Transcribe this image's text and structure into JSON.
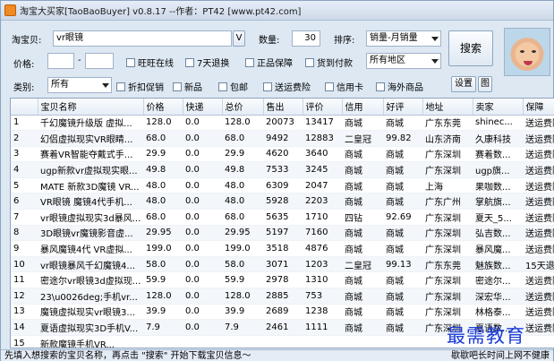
{
  "window": {
    "title": "淘宝大买家[TaoBaoBuyer] v0.8.17 --作者：PT42 [www.pt42.com]"
  },
  "search": {
    "label": "淘宝贝:",
    "value": "vr眼镜",
    "v_button": "V",
    "count_label": "数量:",
    "count_value": "30",
    "sort_label": "排序:",
    "sort_value": "销量-月销量",
    "search_button": "搜索"
  },
  "filters": {
    "price_label": "价格:",
    "price_sep": "-",
    "price_min": "",
    "price_max": "",
    "checks_row1": [
      "旺旺在线",
      "7天退换",
      "正品保障",
      "货到付款"
    ],
    "region_value": "所有地区",
    "category_label": "类别:",
    "category_value": "所有",
    "checks_row2": [
      "折扣促销",
      "新品",
      "包邮",
      "送运费险",
      "信用卡",
      "海外商品"
    ],
    "settings_button": "设置",
    "image_button": "图"
  },
  "table": {
    "columns": [
      "",
      "宝贝名称",
      "价格",
      "快递",
      "总价",
      "售出",
      "评价",
      "信用",
      "好评",
      "地址",
      "卖家",
      "保障"
    ],
    "rows": [
      [
        "1",
        "千幻魔镜升级版 虚拟...",
        "128.0",
        "0.0",
        "128.0",
        "20073",
        "13417",
        "商城",
        "商城",
        "广东东莞",
        "shinec...",
        "送运费险"
      ],
      [
        "2",
        "幻侣虚拟现实VR眼睛...",
        "68.0",
        "0.0",
        "68.0",
        "9492",
        "12883",
        "二皇冠",
        "99.82",
        "山东济南",
        "久康科技",
        "送运费险"
      ],
      [
        "3",
        "赛着VR智能夺戴式手...",
        "29.9",
        "0.0",
        "29.9",
        "4620",
        "3640",
        "商城",
        "商城",
        "广东深圳",
        "赛着数...",
        "送运费险"
      ],
      [
        "4",
        "ugp新款vr虚拟现实眼...",
        "49.8",
        "0.0",
        "49.8",
        "7533",
        "3245",
        "商城",
        "商城",
        "广东深圳",
        "ugp旗...",
        "送运费险"
      ],
      [
        "5",
        "MATE 新款3D魔镜 VR...",
        "48.0",
        "0.0",
        "48.0",
        "6309",
        "2047",
        "商城",
        "商城",
        "上海",
        "果咖数...",
        "送运费险"
      ],
      [
        "6",
        "VR眼镜 魔镜4代手机...",
        "48.0",
        "0.0",
        "48.0",
        "5928",
        "2203",
        "商城",
        "商城",
        "广东广州",
        "掌航旗...",
        "送运费险"
      ],
      [
        "7",
        "vr眼镜虚拟现实3d暴风...",
        "68.0",
        "0.0",
        "68.0",
        "5635",
        "1710",
        "四钻",
        "92.69",
        "广东深圳",
        "夏天_5...",
        "送运费险"
      ],
      [
        "8",
        "3D眼镜vr魔镜影音虚...",
        "29.95",
        "0.0",
        "29.95",
        "5197",
        "7160",
        "商城",
        "商城",
        "广东深圳",
        "弘吉数...",
        "送运费险"
      ],
      [
        "9",
        "暴风魔镜4代 VR虚拟...",
        "199.0",
        "0.0",
        "199.0",
        "3518",
        "4876",
        "商城",
        "商城",
        "广东深圳",
        "暴风魔...",
        "送运费险"
      ],
      [
        "10",
        "vr眼镜暴风千幻魔镜4...",
        "58.0",
        "0.0",
        "58.0",
        "3071",
        "1203",
        "二皇冠",
        "99.13",
        "广东东莞",
        "魅族数...",
        "15天退货"
      ],
      [
        "11",
        "密途尔vr眼镜3d虚拟现...",
        "59.9",
        "0.0",
        "59.9",
        "2978",
        "1310",
        "商城",
        "商城",
        "广东深圳",
        "密途尔...",
        "送运费险"
      ],
      [
        "12",
        "23\\u0026deg;手机vr...",
        "128.0",
        "0.0",
        "128.0",
        "2885",
        "753",
        "商城",
        "商城",
        "广东深圳",
        "深宏华...",
        "送运费险"
      ],
      [
        "13",
        "魔镜虚拟现实vr眼镜3...",
        "39.9",
        "0.0",
        "39.9",
        "2689",
        "1238",
        "商城",
        "商城",
        "广东深圳",
        "林格泰...",
        "送运费险"
      ],
      [
        "14",
        "夏语虚拟现实3D手机V...",
        "7.9",
        "0.0",
        "7.9",
        "2461",
        "1111",
        "商城",
        "商城",
        "广东深圳",
        "夏语数...",
        "送运费险"
      ],
      [
        "15",
        "新款魔镜手机VR...",
        "",
        "",
        "",
        "",
        "",
        "",
        "",
        "",
        "",
        ""
      ]
    ]
  },
  "status": {
    "left": "先填入想搜索的宝贝名称，再点击 \"搜索\" 开始下载宝贝信息～",
    "right": "歇歇吧长时间上网不健康"
  },
  "watermark": "最需教育",
  "colors": {
    "window_bg": "#dde8f3",
    "watermark": "#1a3cd8",
    "titlebar_icon": "#f08a24"
  }
}
